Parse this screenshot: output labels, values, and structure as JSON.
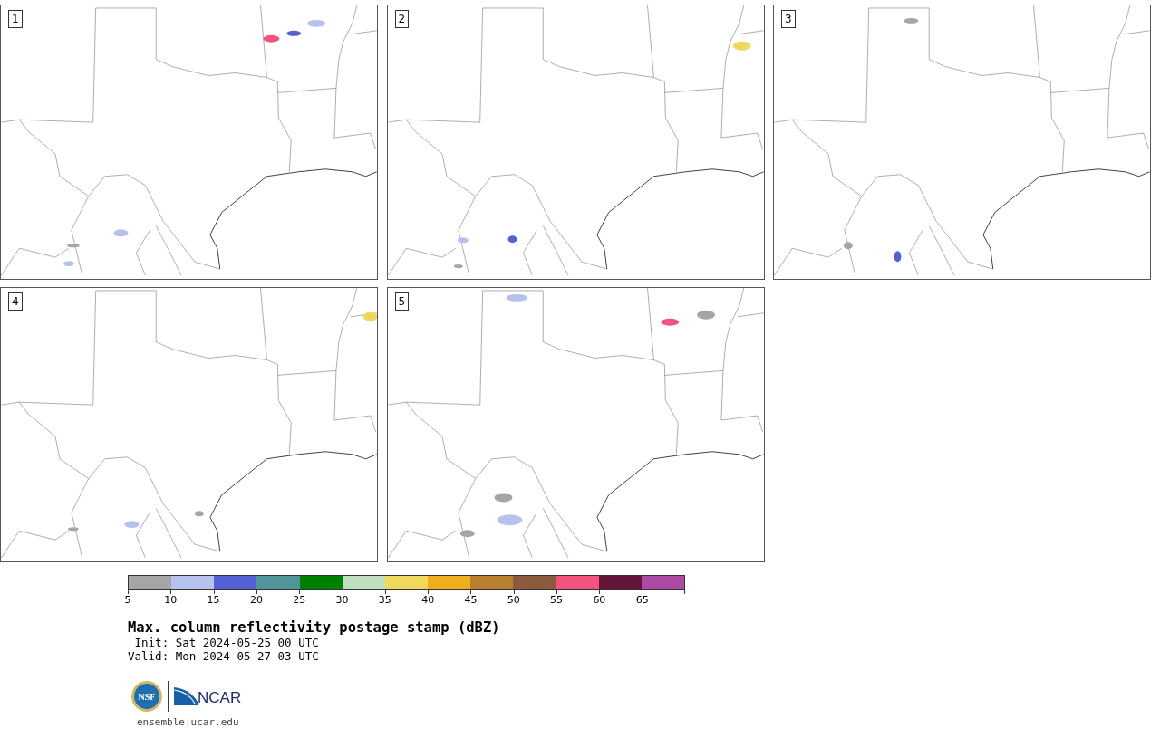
{
  "panels": [
    {
      "label": "1"
    },
    {
      "label": "2"
    },
    {
      "label": "3"
    },
    {
      "label": "4"
    },
    {
      "label": "5"
    }
  ],
  "colorbar": {
    "segments": [
      {
        "color": "#a5a5a5"
      },
      {
        "color": "#b7c2ec"
      },
      {
        "color": "#5461d6"
      },
      {
        "color": "#4f9599"
      },
      {
        "color": "#008000"
      },
      {
        "color": "#bfe0bf"
      },
      {
        "color": "#efd85c"
      },
      {
        "color": "#f0ad1c"
      },
      {
        "color": "#b9802f"
      },
      {
        "color": "#8c5a3c"
      },
      {
        "color": "#f4527f"
      },
      {
        "color": "#63163a"
      },
      {
        "color": "#ad4ba4"
      }
    ],
    "ticks": [
      "5",
      "10",
      "15",
      "20",
      "25",
      "30",
      "35",
      "40",
      "45",
      "50",
      "55",
      "60",
      "65"
    ]
  },
  "title": "Max. column reflectivity postage stamp (dBZ)",
  "init": " Init: Sat 2024-05-25 00 UTC",
  "valid": "Valid: Mon 2024-05-27 03 UTC",
  "logos": {
    "nsf": "NSF",
    "ncar": "NCAR"
  },
  "url": "ensemble.ucar.edu"
}
